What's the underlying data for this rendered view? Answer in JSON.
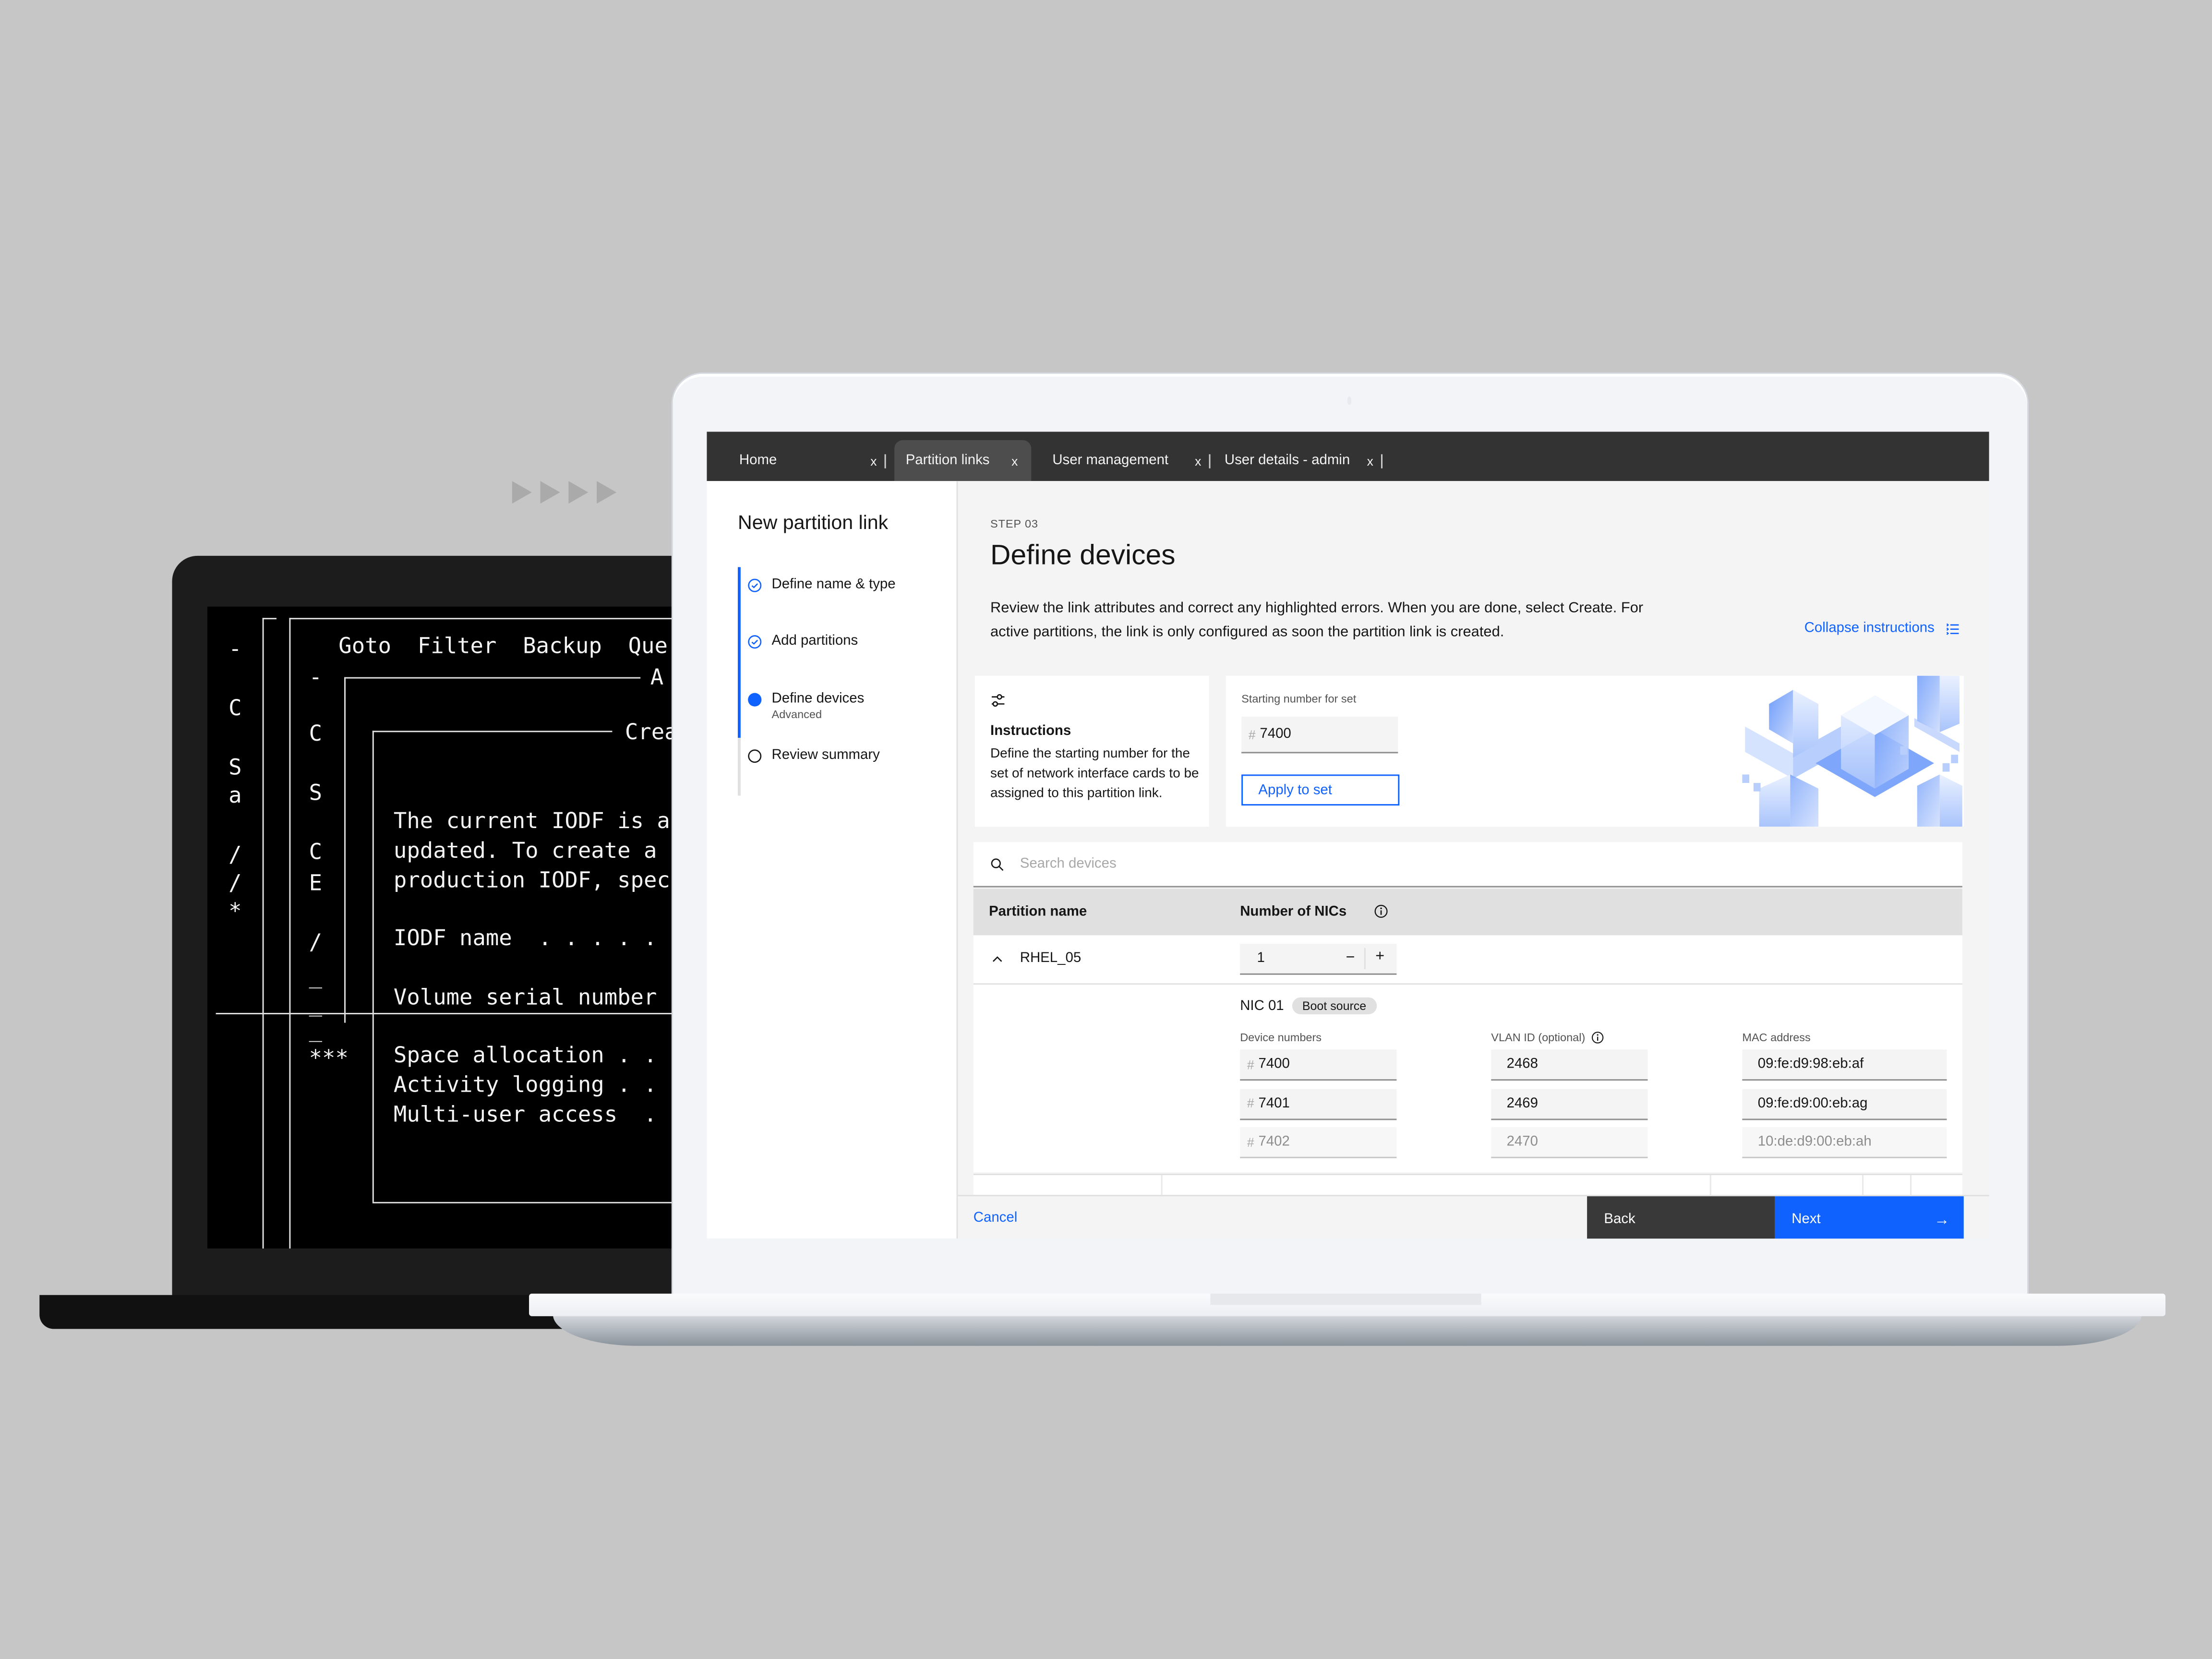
{
  "background_decor": {
    "arrow_count": 4
  },
  "terminal": {
    "menu": "Goto  Filter  Backup  Que",
    "panel_title_1": "A",
    "panel_title_2": "Crea",
    "left_col_1": [
      "-",
      "C",
      "S",
      "a",
      "/",
      "/",
      "*"
    ],
    "left_col_2": [
      "-",
      "C",
      "S",
      "C",
      "E",
      "/",
      "_",
      "_",
      "_",
      "***"
    ],
    "lines": [
      "The current IODF is a",
      "updated. To create a",
      "production IODF, spec",
      "",
      "IODF name  . . . . .",
      "",
      "Volume serial number",
      "",
      "Space allocation . .",
      "Activity logging . .",
      "Multi-user access  ."
    ]
  },
  "app": {
    "tabs": [
      {
        "label": "Home",
        "close": "x",
        "active": false
      },
      {
        "label": "Partition links",
        "close": "x",
        "active": true
      },
      {
        "label": "User management",
        "close": "x",
        "active": false
      },
      {
        "label": "User details - admin",
        "close": "x",
        "active": false
      }
    ],
    "wizard": {
      "title": "New partition link",
      "steps": [
        {
          "label": "Define name & type",
          "sub": "",
          "state": "complete"
        },
        {
          "label": "Add partitions",
          "sub": "",
          "state": "complete"
        },
        {
          "label": "Define devices",
          "sub": "Advanced",
          "state": "current"
        },
        {
          "label": "Review summary",
          "sub": "",
          "state": "incomplete"
        }
      ]
    },
    "main": {
      "step_number": "STEP 03",
      "title": "Define devices",
      "description": "Review the link attributes and correct any highlighted errors. When you are done, select Create. For active partitions, the link is only configured as soon the partition link is created.",
      "collapse_label": "Collapse instructions",
      "instructions": {
        "title": "Instructions",
        "body": "Define the starting number for the set of network interface cards to be assigned to this partition link."
      },
      "starting_number": {
        "label": "Starting number for set",
        "prefix": "#",
        "value": "7400",
        "apply_label": "Apply to set"
      },
      "search_placeholder": "Search devices",
      "table": {
        "headers": [
          "Partition name",
          "Number of NICs"
        ],
        "rows": [
          {
            "name": "RHEL_05",
            "nics": "1",
            "expanded": true
          }
        ]
      },
      "nic": {
        "title": "NIC 01",
        "tag": "Boot source",
        "columns": [
          "Device numbers",
          "VLAN ID (optional)",
          "MAC address"
        ],
        "rows": [
          {
            "device": "7400",
            "vlan": "2468",
            "mac": "09:fe:d9:98:eb:af"
          },
          {
            "device": "7401",
            "vlan": "2469",
            "mac": "09:fe:d9:00:eb:ag"
          },
          {
            "device": "7402",
            "vlan": "2470",
            "mac": "10:de:d9:00:eb:ah"
          }
        ]
      },
      "footer": {
        "cancel": "Cancel",
        "back": "Back",
        "next": "Next"
      }
    },
    "colors": {
      "primary": "#0f62fe",
      "tabbar": "#333333",
      "back_button": "#393939"
    }
  }
}
